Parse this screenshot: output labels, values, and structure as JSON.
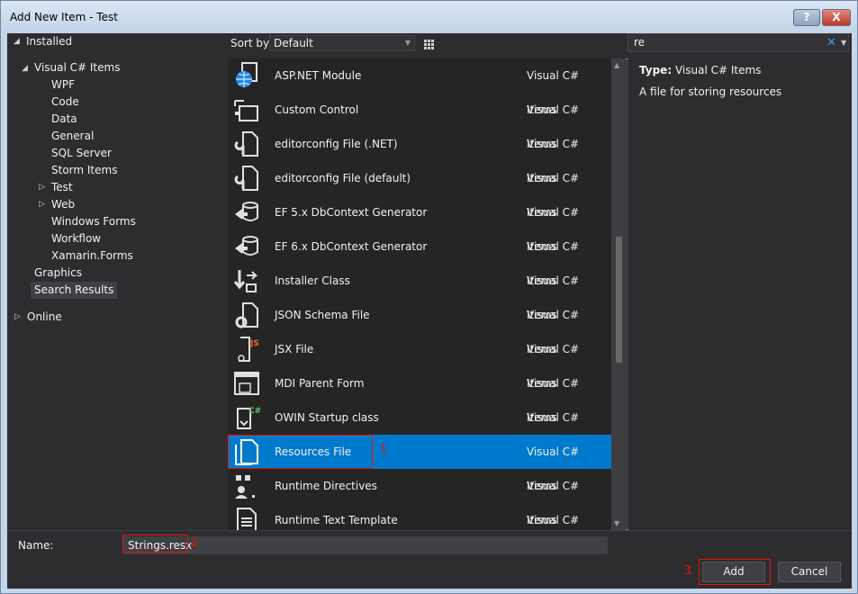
{
  "window": {
    "title": "Add New Item - Test",
    "help_label": "?",
    "close_label": "X"
  },
  "tree": {
    "installed": "Installed",
    "visual_csharp": "Visual C# Items",
    "children": [
      "WPF",
      "Code",
      "Data",
      "General",
      "SQL Server",
      "Storm Items",
      "Test",
      "Web",
      "Windows Forms",
      "Workflow",
      "Xamarin.Forms"
    ],
    "graphics": "Graphics",
    "search_results": "Search Results",
    "online": "Online"
  },
  "toolbar": {
    "sort_label": "Sort by:",
    "sort_value": "Default",
    "search_value": "re"
  },
  "items": [
    {
      "name": "ASP.NET Module",
      "category": "Visual C# Items",
      "icon": "globe-icon"
    },
    {
      "name": "Custom Control",
      "category": "Visual C# Items",
      "icon": "custom-control-icon"
    },
    {
      "name": "editorconfig File (.NET)",
      "category": "Visual C# Items",
      "icon": "wrench-file-icon"
    },
    {
      "name": "editorconfig File (default)",
      "category": "Visual C# Items",
      "icon": "wrench-file-icon"
    },
    {
      "name": "EF 5.x DbContext Generator",
      "category": "Visual C# Items",
      "icon": "ef-generator-icon"
    },
    {
      "name": "EF 6.x DbContext Generator",
      "category": "Visual C# Items",
      "icon": "ef-generator-icon"
    },
    {
      "name": "Installer Class",
      "category": "Visual C# Items",
      "icon": "installer-icon"
    },
    {
      "name": "JSON Schema File",
      "category": "Visual C# Items",
      "icon": "json-schema-icon"
    },
    {
      "name": "JSX File",
      "category": "Visual C# Items",
      "icon": "jsx-file-icon"
    },
    {
      "name": "MDI Parent Form",
      "category": "Visual C# Items",
      "icon": "form-icon"
    },
    {
      "name": "OWIN Startup class",
      "category": "Visual C# Items",
      "icon": "owin-icon"
    },
    {
      "name": "Resources File",
      "category": "Visual C# Items",
      "icon": "resources-file-icon"
    },
    {
      "name": "Runtime Directives",
      "category": "Visual C# Items",
      "icon": "runtime-directives-icon"
    },
    {
      "name": "Runtime Text Template",
      "category": "Visual C# Items",
      "icon": "text-template-icon"
    }
  ],
  "selected_index": 11,
  "description": {
    "type_label": "Type:",
    "type_value": "Visual C# Items",
    "text": "A file for storing resources"
  },
  "bottom": {
    "name_label": "Name:",
    "name_value": "Strings.resx",
    "add_label": "Add",
    "cancel_label": "Cancel"
  },
  "annotations": [
    "1",
    "2",
    "3"
  ],
  "colors": {
    "accent": "#007acc",
    "annotation": "#e51400",
    "background": "#2d2d30"
  }
}
